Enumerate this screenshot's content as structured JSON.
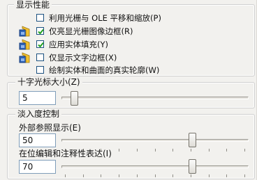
{
  "display_performance": {
    "title": "显示性能",
    "options": [
      {
        "label": "利用光栅与 OLE 平移和缩放(P)",
        "checked": false,
        "icon": "none"
      },
      {
        "label": "仅亮显光栅图像边框(R)",
        "checked": true,
        "icon": "drawing-setting-icon"
      },
      {
        "label": "应用实体填充(Y)",
        "checked": true,
        "icon": "drawing-setting-icon"
      },
      {
        "label": "仅显示文字边框(X)",
        "checked": false,
        "icon": "drawing-setting-icon"
      },
      {
        "label": "绘制实体和曲面的真实轮廓(W)",
        "checked": false,
        "icon": "none"
      }
    ]
  },
  "crosshair": {
    "title": "十字光标大小(Z)",
    "value": "5",
    "slider_fraction": 0.05
  },
  "fade": {
    "title": "淡入度控制",
    "xref": {
      "label": "外部参照显示(E)",
      "value": "50",
      "slider_fraction": 0.71
    },
    "inplace": {
      "label": "在位编辑和注释性表达(I)",
      "value": "70",
      "slider_fraction": 0.71
    }
  },
  "colors": {
    "checkbox_border": "#1c5180",
    "check_mark": "#21a121",
    "input_border": "#7f9db9"
  }
}
